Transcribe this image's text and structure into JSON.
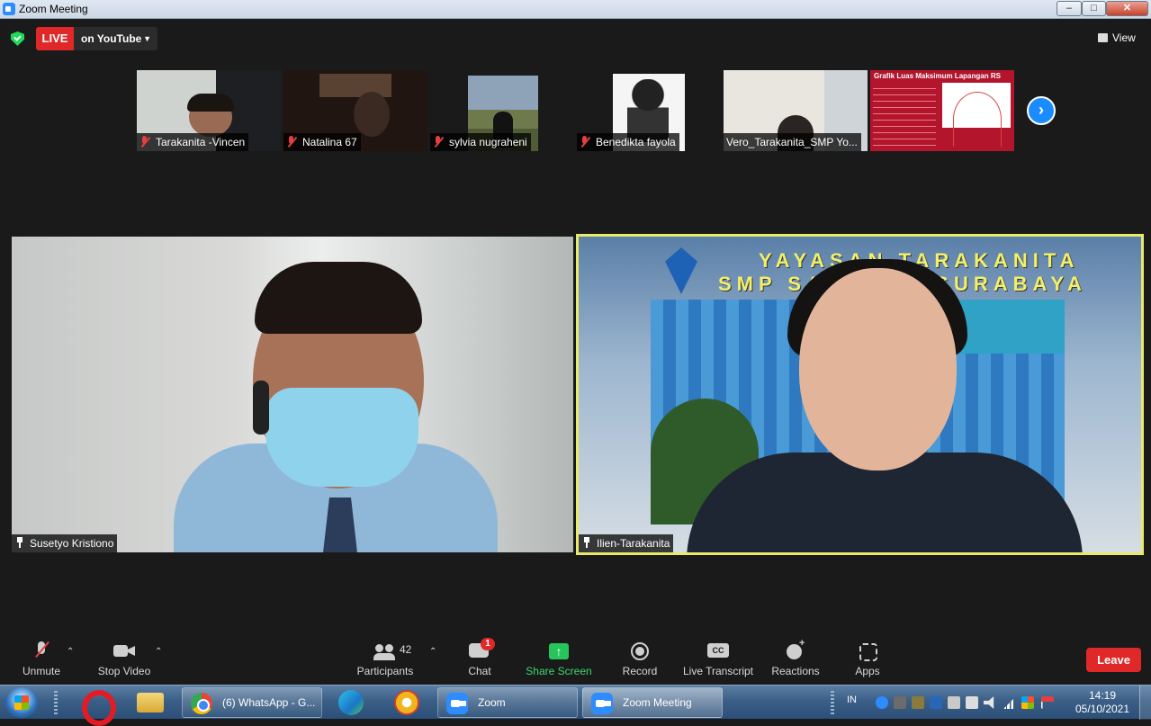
{
  "window": {
    "title": "Zoom Meeting"
  },
  "topbar": {
    "live_label": "LIVE",
    "stream_target": "on YouTube",
    "view_label": "View"
  },
  "thumbnails": [
    {
      "name": "Tarakanita -Vincen",
      "muted": true
    },
    {
      "name": "Natalina 67",
      "muted": true
    },
    {
      "name": "sylvia nugraheni",
      "muted": true
    },
    {
      "name": "Benedikta fayola",
      "muted": true
    },
    {
      "name": "Vero_Tarakanita_SMP Yo...",
      "muted": false
    },
    {
      "name": "",
      "slide_title": "Grafik Luas Maksimum Lapangan RS",
      "muted": false
    }
  ],
  "main_videos": [
    {
      "name": "Susetyo Kristiono",
      "pinned": true,
      "active_speaker": false
    },
    {
      "name": "Ilien-Tarakanita",
      "pinned": true,
      "active_speaker": true,
      "background_sign_line1": "YAYASAN TARAKANITA",
      "background_sign_line2": "SMP SANTA ... SURABAYA"
    }
  ],
  "toolbar": {
    "unmute": "Unmute",
    "stop_video": "Stop Video",
    "participants": "Participants",
    "participants_count": "42",
    "chat": "Chat",
    "chat_badge": "1",
    "share_screen": "Share Screen",
    "record": "Record",
    "live_transcript": "Live Transcript",
    "reactions": "Reactions",
    "apps": "Apps",
    "leave": "Leave"
  },
  "taskbar": {
    "tasks": [
      {
        "label": "(6) WhatsApp - G..."
      },
      {
        "label": "Zoom"
      },
      {
        "label": "Zoom Meeting"
      }
    ],
    "language": "IN",
    "time": "14:19",
    "date": "05/10/2021"
  },
  "colors": {
    "live_red": "#e02828",
    "share_green": "#26c55b",
    "active_speaker_border": "#e8ea6a",
    "zoom_blue": "#2d8cff"
  }
}
